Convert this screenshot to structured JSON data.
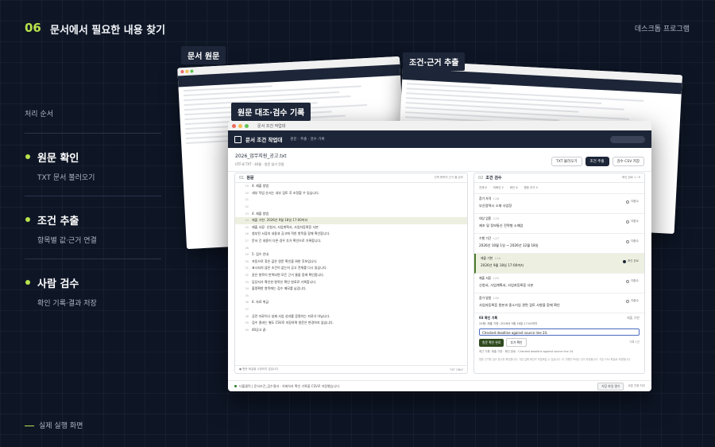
{
  "header": {
    "number": "06",
    "title": "문서에서 필요한 내용 찾기",
    "right_label": "데스크톱 프로그램"
  },
  "sidebar": {
    "label": "처리 순서",
    "steps": [
      {
        "title": "원문 확인",
        "subtitle": "TXT 문서 불러오기"
      },
      {
        "title": "조건 추출",
        "subtitle": "항목별 값·근거 연결"
      },
      {
        "title": "사람 검수",
        "subtitle": "확인 기록·결과 저장"
      }
    ]
  },
  "footer": {
    "label": "실제 실행 화면"
  },
  "tags": {
    "source": "문서 원문",
    "extract": "조건·근거 추출",
    "compare": "원문 대조·검수 기록"
  },
  "window": {
    "title": "문서 조건 작업대",
    "app_name": "문서 조건 작업대",
    "crumb": "원문 · 추출 · 검수 기록",
    "file_name": "2026_업무지원_공고.txt",
    "file_meta": "UTF-8 TXT · 40줄 · 원문 읽기 전용",
    "btn_open": "TXT 불러오기",
    "btn_extract": "조건 추출",
    "btn_save": "검수 CSV 저장"
  },
  "source_pane": {
    "num": "01",
    "title": "원문",
    "right": "선택 항목의 근거 줄 강조",
    "lines": [
      {
        "n": "19",
        "t": "4. 제출 방법"
      },
      {
        "n": "20",
        "t": "세부 작업 순서는 내부 검토 후 조정할 수 있습니다."
      },
      {
        "n": "21",
        "t": ""
      },
      {
        "n": "22",
        "t": ""
      },
      {
        "n": "23",
        "t": "4. 제출 방법"
      },
      {
        "n": "24",
        "t": "제출 기한: 2026년 9월 18일 17:00까지"
      },
      {
        "n": "25",
        "t": "제출 서류: 신청서, 사업계획서, 사업자등록증 사본"
      },
      {
        "n": "26",
        "t": "첨부된 서류의 내용과 공고에 적힌 항목을 함께 확인합니다."
      },
      {
        "n": "27",
        "t": "문서 간 내용이 다른 경우 추가 확인으로 기록합니다."
      },
      {
        "n": "28",
        "t": ""
      },
      {
        "n": "29",
        "t": "5. 검수 안내"
      },
      {
        "n": "30",
        "t": "자동으로 찾은 값은 원문 확인을 위한 후보입니다."
      },
      {
        "n": "31",
        "t": "표시되지 않은 조건이 없는지 공고 전체를 다시 읽습니다."
      },
      {
        "n": "32",
        "t": "같은 항목이 반복되면 모든 근거 줄을 함께 확인합니다."
      },
      {
        "n": "33",
        "t": "담당자가 확인한 항목은 확인 완료로 기록합니다."
      },
      {
        "n": "34",
        "t": "불명확한 항목에는 검수 메모를 남깁니다."
      },
      {
        "n": "35",
        "t": ""
      },
      {
        "n": "36",
        "t": "6. 자료 취급"
      },
      {
        "n": "37",
        "t": ""
      },
      {
        "n": "38",
        "t": "공란 자료이나 실제 사업 성과를 증명하는 자료가 아닙니다."
      },
      {
        "n": "39",
        "t": "검수 결과는 별도 CSV로 저장하며 원문은 변경하지 않습니다."
      },
      {
        "n": "40",
        "t": "40공고 끝."
      }
    ],
    "footer_left": "● 원문 화살을 수정하지 않습니다",
    "footer_right": "TXT ONLY"
  },
  "review_pane": {
    "num": "02",
    "title": "조건 검수",
    "right": "확인 완료 1 / 6",
    "tabs": [
      "전체 6",
      "미확인 5",
      "확인 6",
      "활동 추가 0"
    ],
    "items": [
      {
        "key": "참가 자격",
        "id": "L18",
        "value": "부산광역시 소재 사업장",
        "status": "미완수"
      },
      {
        "key": "대상 업종",
        "id": "L15",
        "value": "제조 및 정보통신 전략형 소매업",
        "status": "미완수"
      },
      {
        "key": "수행 기간",
        "id": "L17",
        "value": "2026년 10월 1일 ~ 2026년 12월 18일",
        "status": "미완수"
      },
      {
        "key": "제출 기한",
        "id": "L24",
        "value": "2026년 9월 18일 17:00까지",
        "status": "확인 완료"
      },
      {
        "key": "제출 서류",
        "id": "L25",
        "value": "신청서, 사업계획서, 사업자등록증 사본",
        "status": "미완수"
      },
      {
        "key": "참가 방법",
        "id": "L32",
        "value": "사업자등록증 원본과 중소기업 관련 검토 사항을 함께 확인",
        "status": "미완수"
      }
    ],
    "record": {
      "title": "03 확인 기록",
      "right": "제출 기한",
      "question": "24행: 제출 기한: 2026년 9월 18일 17:00까지",
      "input_value": "Checked deadline against source line 24.",
      "ok": "원문 확인 완료",
      "alt": "추가 확인",
      "counter": "기록 1건",
      "note": "최근 기록: 제출 기한 · 확인 완료 · Checked deadline against source line 24.",
      "help": "원문 근거를 읽고 표시를 확인합니다. 기본 값에 확인이 직접적일 수 있습니다. 이 기록만 보내는 것이 저장됩니다. 기존 CSV 파일로 저장합니다."
    }
  },
  "status_bar": {
    "text": "더블클릭 | 문서조건_검수결과 · 삭제하지 확인 기록을 CSV로 저장했습니다.",
    "open_btn": "저장 파일 열기",
    "right": "로컬 전용 처리"
  }
}
